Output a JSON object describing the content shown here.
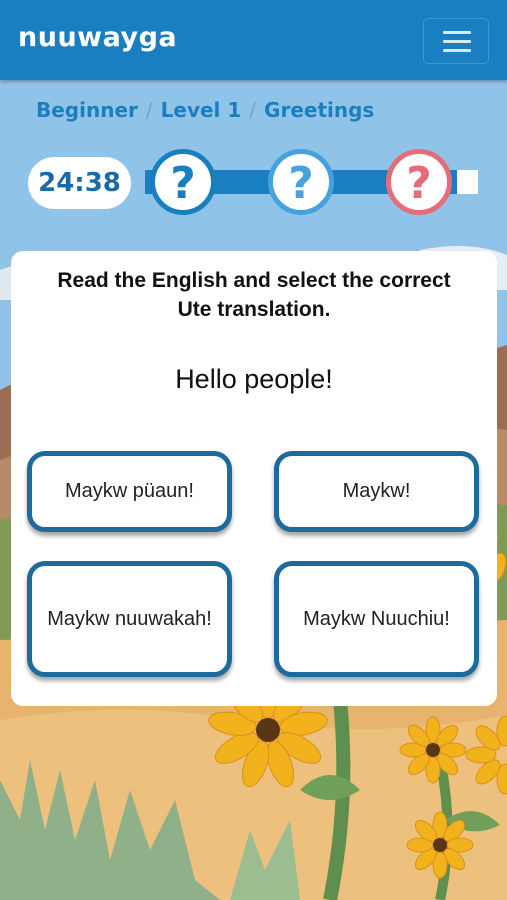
{
  "app": {
    "brand": "nuuwayga"
  },
  "breadcrumb": {
    "level0": "Beginner",
    "level1": "Level 1",
    "level2": "Greetings",
    "separator": "/"
  },
  "timer": {
    "value": "24:38"
  },
  "progress": {
    "questions": [
      {
        "symbol": "?",
        "state": "current"
      },
      {
        "symbol": "?",
        "state": "pending"
      },
      {
        "symbol": "?",
        "state": "pending-alert"
      }
    ]
  },
  "quiz": {
    "instruction": "Read the English and select the correct Ute translation.",
    "prompt": "Hello people!",
    "options": [
      "Maykw püaun!",
      "Maykw!",
      "Maykw nuuwakah!",
      "Maykw Nuuchiu!"
    ]
  },
  "colors": {
    "primary": "#1a7fc1",
    "option_border": "#1d6a9e",
    "alert": "#e46c7b",
    "sky": "#8fc3e8"
  },
  "icons": {
    "menu": "hamburger-icon",
    "question": "question-mark-icon",
    "scenery": "sunflower-icon"
  }
}
